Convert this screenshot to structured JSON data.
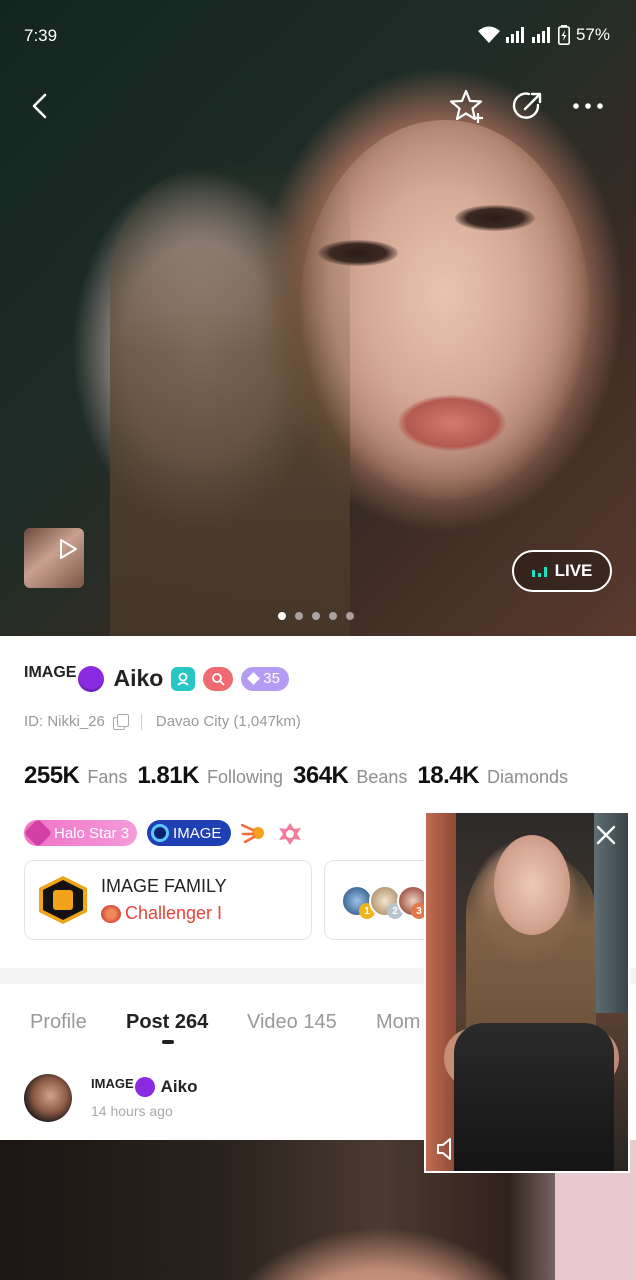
{
  "status_bar": {
    "time": "7:39",
    "battery": "57%"
  },
  "header": {
    "icons": [
      "back-arrow-icon",
      "star-plus-icon",
      "share-icon",
      "more-icon"
    ]
  },
  "hero": {
    "live_label": "LIVE",
    "page_count": 5,
    "active_page": 1
  },
  "profile": {
    "family_tag": "IMAGE",
    "name": "Aiko",
    "level": "35",
    "id_text": "ID: Nikki_26",
    "location": "Davao City (1,047km)"
  },
  "stats": [
    {
      "value": "255K",
      "label": "Fans"
    },
    {
      "value": "1.81K",
      "label": "Following"
    },
    {
      "value": "364K",
      "label": "Beans"
    },
    {
      "value": "18.4K",
      "label": "Diamonds"
    }
  ],
  "badges": {
    "halo": "Halo Star 3",
    "image": "IMAGE"
  },
  "family_card": {
    "name": "IMAGE FAMILY",
    "rank": "Challenger I"
  },
  "fan_ranks": [
    "1",
    "2",
    "3"
  ],
  "tabs": [
    {
      "label": "Profile",
      "active": false
    },
    {
      "label": "Post 264",
      "active": true
    },
    {
      "label": "Video 145",
      "active": false
    },
    {
      "label": "Mom",
      "active": false
    }
  ],
  "post": {
    "family_tag": "IMAGE",
    "author": "Aiko",
    "time": "14 hours ago"
  },
  "colors": {
    "live_accent": "#20e0c2",
    "family_rank": "#e8443a",
    "level_pill": "#b49cf2",
    "image_pill": "#1f3fb5",
    "halo_pill": "#f172c7"
  }
}
